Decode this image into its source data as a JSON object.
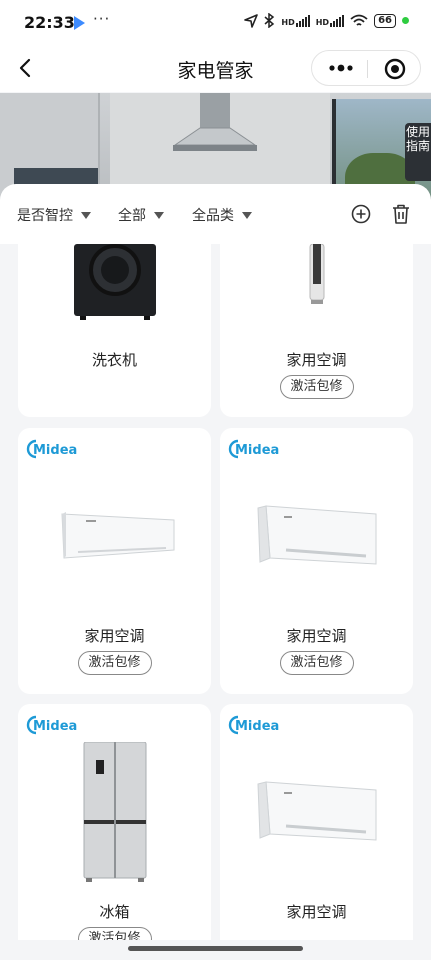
{
  "status_bar": {
    "time": "22:33",
    "more": "···",
    "hd1": "HD",
    "hd2": "HD",
    "battery": "66"
  },
  "nav": {
    "title": "家电管家"
  },
  "banner": {
    "guide_label": "使用指南"
  },
  "filters": [
    {
      "label": "是否智控"
    },
    {
      "label": "全部"
    },
    {
      "label": "全品类"
    }
  ],
  "cards": [
    {
      "name": "洗衣机",
      "brand": "",
      "button": "",
      "icon": "washing-machine"
    },
    {
      "name": "家用空调",
      "brand": "",
      "button": "激活包修",
      "icon": "floor-ac"
    },
    {
      "name": "家用空调",
      "brand": "Midea",
      "button": "激活包修",
      "icon": "wall-ac"
    },
    {
      "name": "家用空调",
      "brand": "Midea",
      "button": "激活包修",
      "icon": "wall-ac"
    },
    {
      "name": "冰箱",
      "brand": "Midea",
      "button": "激活包修",
      "icon": "refrigerator"
    },
    {
      "name": "家用空调",
      "brand": "Midea",
      "button": "",
      "icon": "wall-ac"
    }
  ],
  "colors": {
    "midea_blue": "#1e9ad6",
    "page_bg": "#f4f5f7"
  }
}
